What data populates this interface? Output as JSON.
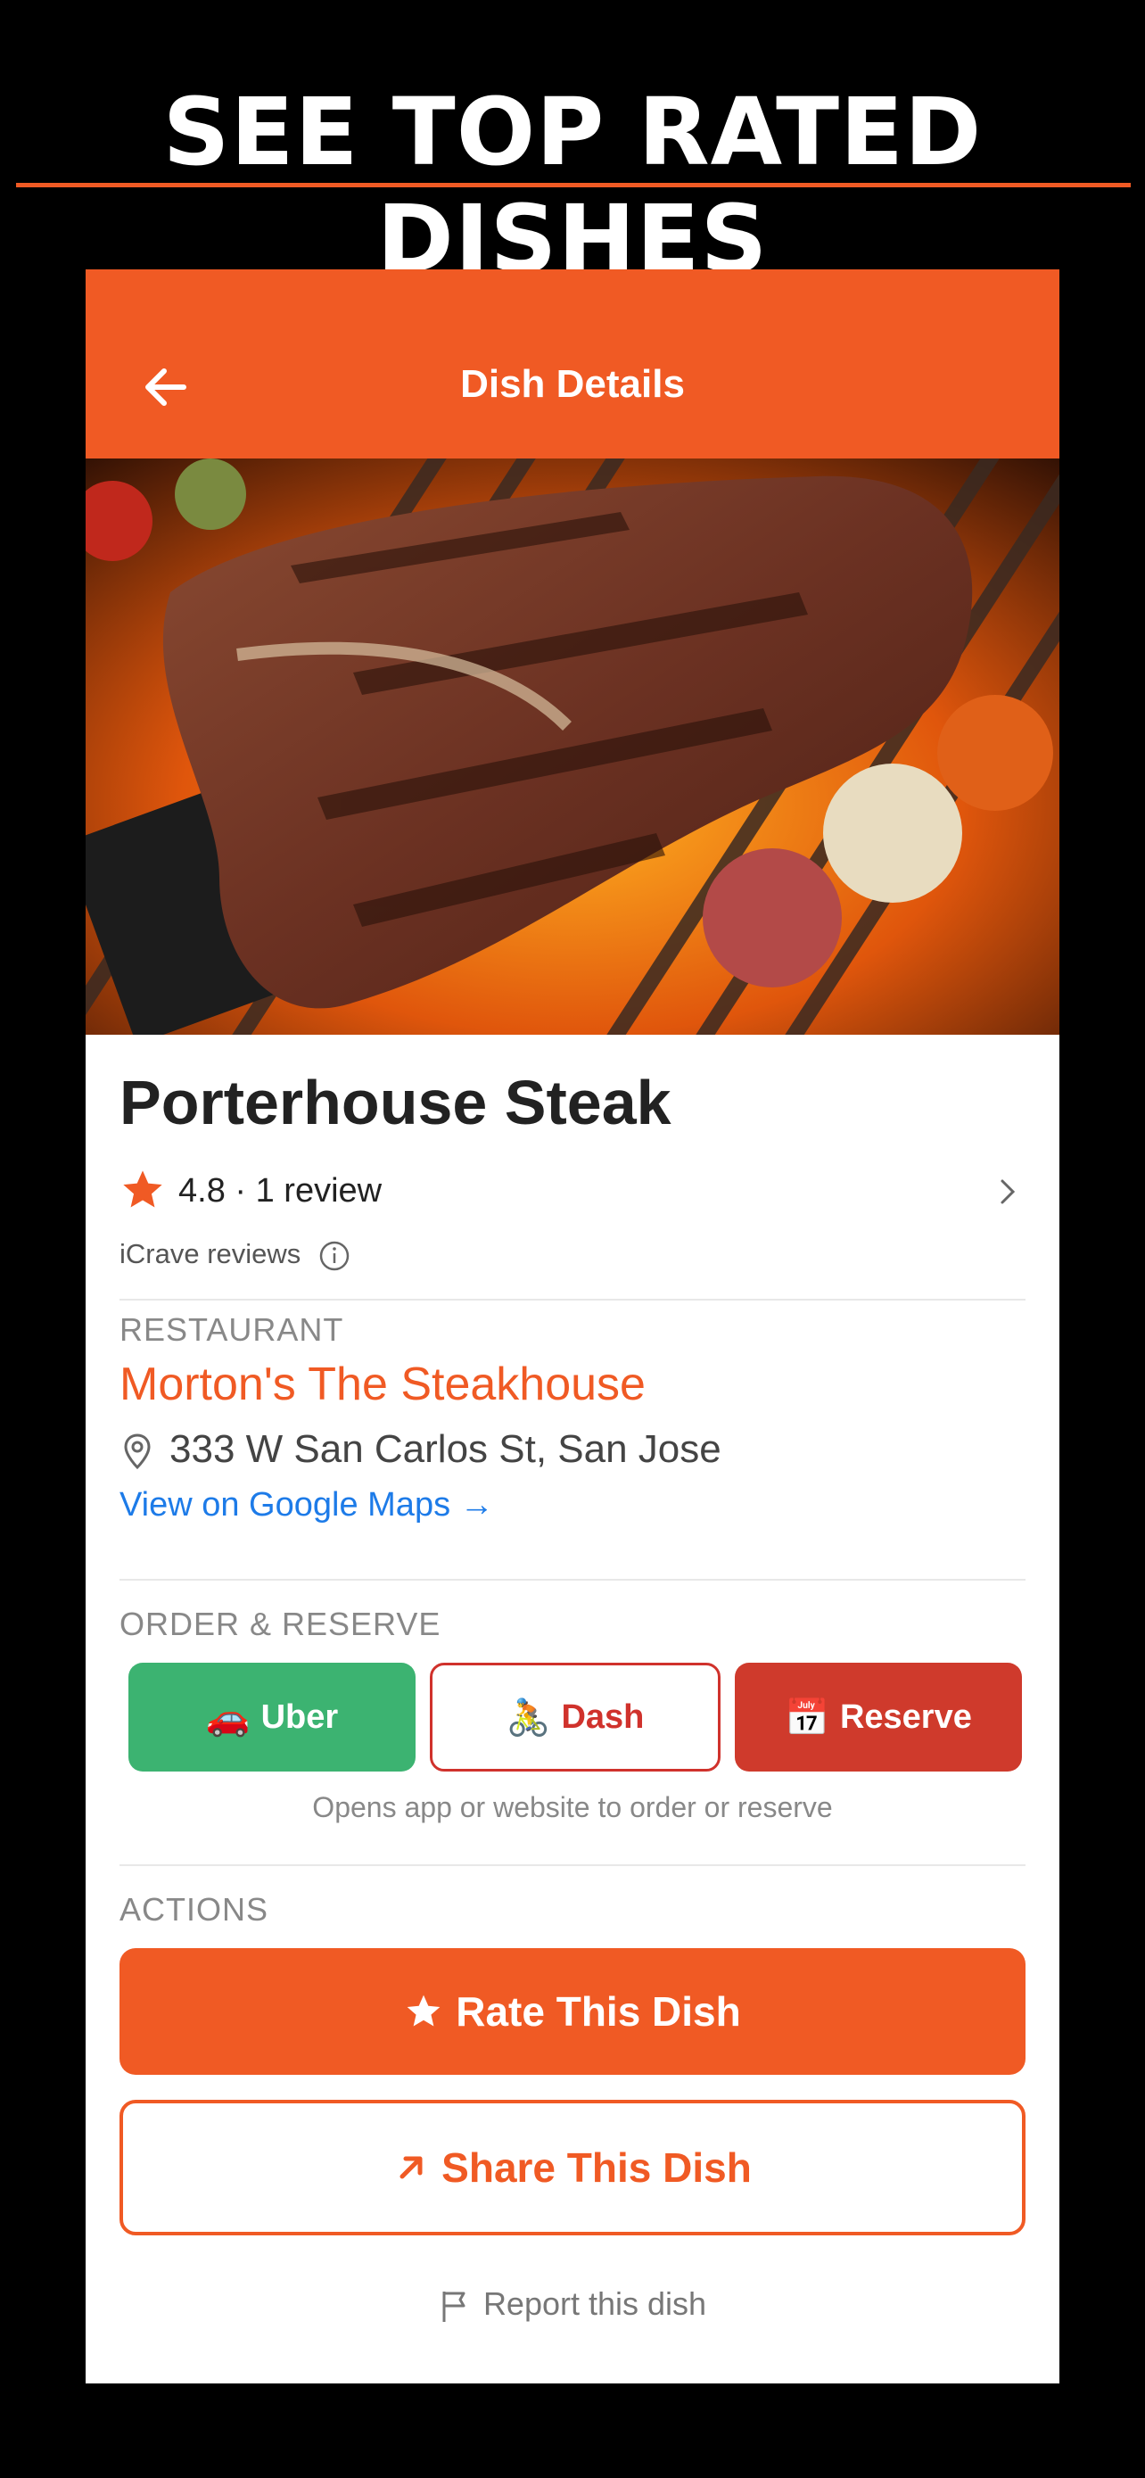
{
  "promo": {
    "title": "SEE TOP RATED DISHES"
  },
  "header": {
    "title": "Dish Details",
    "back_icon": "arrow-left-icon"
  },
  "dish": {
    "name": "Porterhouse Steak",
    "rating_text": "4.8 · 1 review",
    "source_text": "iCrave reviews"
  },
  "restaurant": {
    "label": "RESTAURANT",
    "name": "Morton's The Steakhouse",
    "address": "333 W San Carlos St, San Jose",
    "maps_link": "View on Google Maps →"
  },
  "order": {
    "label": "ORDER & RESERVE",
    "buttons": [
      {
        "emoji": "🚗",
        "label": "Uber",
        "color": "#3cb371"
      },
      {
        "emoji": "🚴",
        "label": "Dash",
        "color": "#d0322c"
      },
      {
        "emoji": "📅",
        "label": "Reserve",
        "color": "#cf3a2c"
      }
    ],
    "note": "Opens app or website to order or reserve"
  },
  "actions": {
    "label": "ACTIONS",
    "rate_label": "Rate This Dish",
    "share_label": "Share This Dish",
    "report_label": "Report this dish"
  },
  "colors": {
    "brand": "#f05a24",
    "link": "#1d7be8",
    "uber": "#3cb371",
    "reserve": "#cf3a2c"
  }
}
